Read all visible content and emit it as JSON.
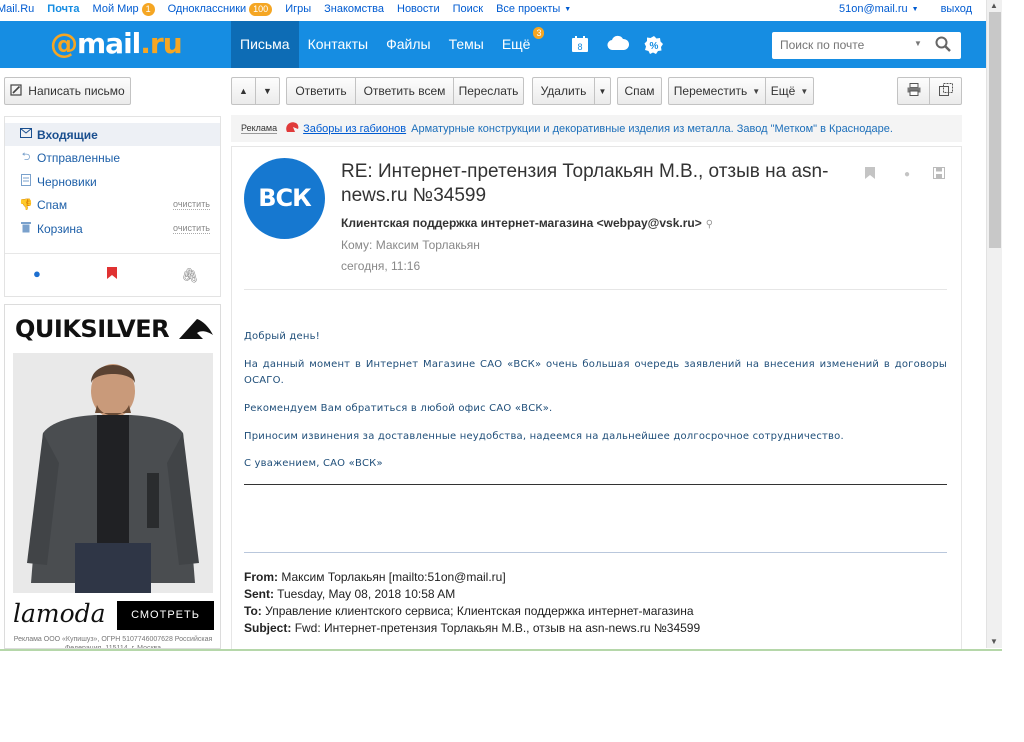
{
  "portal": {
    "links": [
      "Mail.Ru",
      "Почта",
      "Мой Мир",
      "Одноклассники",
      "Игры",
      "Знакомства",
      "Новости",
      "Поиск",
      "Все проекты"
    ],
    "moimir_badge": "1",
    "ok_badge": "100",
    "user": "51on@mail.ru",
    "logout": "выход"
  },
  "header": {
    "logo_at": "@",
    "logo_mail": "mail",
    "logo_dot": ".",
    "logo_ru": "ru",
    "nav": [
      "Письма",
      "Контакты",
      "Файлы",
      "Темы",
      "Ещё"
    ],
    "more_badge": "3",
    "calendar_day": "8",
    "search_placeholder": "Поиск по почте"
  },
  "toolbar": {
    "compose": "Написать письмо",
    "reply": "Ответить",
    "reply_all": "Ответить всем",
    "forward": "Переслать",
    "delete": "Удалить",
    "spam": "Спам",
    "move": "Переместить",
    "more": "Ещё"
  },
  "folders": {
    "items": [
      {
        "label": "Входящие",
        "clean": ""
      },
      {
        "label": "Отправленные",
        "clean": ""
      },
      {
        "label": "Черновики",
        "clean": ""
      },
      {
        "label": "Спам",
        "clean": "очистить"
      },
      {
        "label": "Корзина",
        "clean": "очистить"
      }
    ]
  },
  "ad_side": {
    "brand": "QUIKSILVER",
    "lamoda": "lamoda",
    "cta": "СМОТРЕТЬ",
    "legal": "Реклама ООО «Купишуз», ОГРН 5107746007628 Российская Федерация, 115114, г. Москва"
  },
  "ad_strip": {
    "tag": "Реклама",
    "title": "Заборы из габионов",
    "desc": "Арматурные конструкции и декоративные изделия из металла. Завод \"Метком\" в Краснодаре."
  },
  "message": {
    "avatar": "ВСК",
    "subject": "RE: Интернет-претензия Торлакьян М.В., отзыв на asn-news.ru №34599",
    "from": "Клиентская поддержка интернет-магазина <webpay@vsk.ru>",
    "to": "Кому: Максим Торлакьян",
    "date": "сегодня, 11:16",
    "body": [
      "Добрый день!",
      "На данный момент в Интернет Магазине САО «ВСК» очень большая очередь заявлений на внесения изменений в договоры ОСАГО.",
      "Рекомендуем Вам обратиться в любой офис САО «ВСК».",
      "Приносим извинения за доставленные неудобства, надеемся на дальнейшее долгосрочное сотрудничество.",
      "С уважением, САО «ВСК»"
    ],
    "quoted": {
      "from_label": "From:",
      "from": "Максим Торлакьян [mailto:51on@mail.ru]",
      "sent_label": "Sent:",
      "sent": "Tuesday, May 08, 2018 10:58 AM",
      "to_label": "To:",
      "to": "Управление клиентского сервиса; Клиентская поддержка интернет-магазина",
      "subject_label": "Subject:",
      "subject": "Fwd: Интернет-претензия Торлакьян М.В., отзыв на asn-news.ru №34599"
    }
  }
}
